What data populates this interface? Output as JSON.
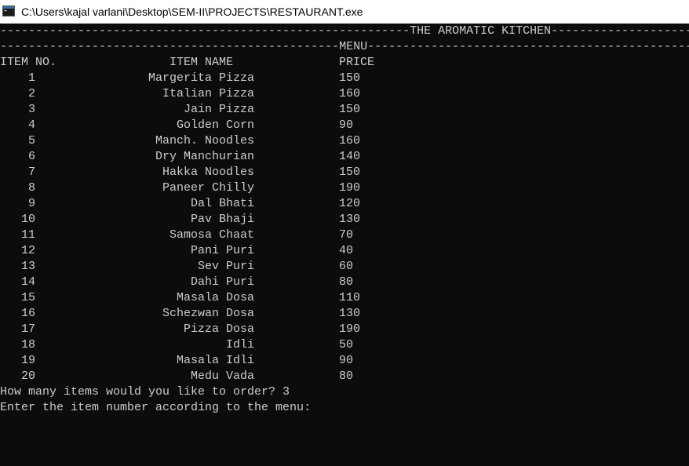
{
  "window": {
    "title": "C:\\Users\\kajal varlani\\Desktop\\SEM-II\\PROJECTS\\RESTAURANT.exe",
    "icon": "console-window-icon"
  },
  "console": {
    "banner_line": "----------------------------------------------------------THE AROMATIC KITCHEN-----------------------",
    "menu_line": "------------------------------------------------MENU-------------------------------------------------",
    "headers": {
      "item_no": "ITEM NO.",
      "item_name": "ITEM NAME",
      "price": "PRICE"
    },
    "items": [
      {
        "no": "1",
        "name": "Margerita Pizza",
        "price": "150"
      },
      {
        "no": "2",
        "name": "Italian Pizza",
        "price": "160"
      },
      {
        "no": "3",
        "name": "Jain Pizza",
        "price": "150"
      },
      {
        "no": "4",
        "name": "Golden Corn",
        "price": "90"
      },
      {
        "no": "5",
        "name": "Manch. Noodles",
        "price": "160"
      },
      {
        "no": "6",
        "name": "Dry Manchurian",
        "price": "140"
      },
      {
        "no": "7",
        "name": "Hakka Noodles",
        "price": "150"
      },
      {
        "no": "8",
        "name": "Paneer Chilly",
        "price": "190"
      },
      {
        "no": "9",
        "name": "Dal Bhati",
        "price": "120"
      },
      {
        "no": "10",
        "name": "Pav Bhaji",
        "price": "130"
      },
      {
        "no": "11",
        "name": "Samosa Chaat",
        "price": "70"
      },
      {
        "no": "12",
        "name": "Pani Puri",
        "price": "40"
      },
      {
        "no": "13",
        "name": "Sev Puri",
        "price": "60"
      },
      {
        "no": "14",
        "name": "Dahi Puri",
        "price": "80"
      },
      {
        "no": "15",
        "name": "Masala Dosa",
        "price": "110"
      },
      {
        "no": "16",
        "name": "Schezwan Dosa",
        "price": "130"
      },
      {
        "no": "17",
        "name": "Pizza Dosa",
        "price": "190"
      },
      {
        "no": "18",
        "name": "Idli",
        "price": "50"
      },
      {
        "no": "19",
        "name": "Masala Idli",
        "price": "90"
      },
      {
        "no": "20",
        "name": "Medu Vada",
        "price": "80"
      }
    ],
    "prompt_count": "How many items would you like to order? 3",
    "prompt_item": "Enter the item number according to the menu:"
  },
  "colors": {
    "background": "#0c0c0c",
    "text": "#cccccc",
    "titlebar": "#ffffff"
  }
}
